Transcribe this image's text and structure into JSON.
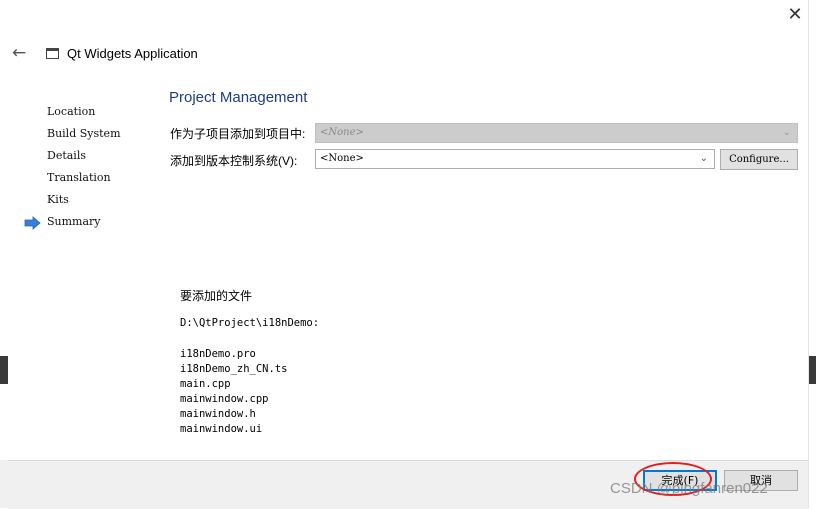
{
  "window": {
    "close_glyph": "✕",
    "back_glyph": "←",
    "title": "Qt Widgets Application"
  },
  "steps": [
    {
      "label": "Location"
    },
    {
      "label": "Build System"
    },
    {
      "label": "Details"
    },
    {
      "label": "Translation"
    },
    {
      "label": "Kits"
    },
    {
      "label": "Summary",
      "current": true
    }
  ],
  "page": {
    "title": "Project Management",
    "subproject_label": "作为子项目添加到项目中:",
    "subproject_value": "<None>",
    "vcs_label": "添加到版本控制系统(V):",
    "vcs_value": "<None>",
    "configure_label": "Configure..."
  },
  "summary": {
    "title": "要添加的文件",
    "path": "D:\\QtProject\\i18nDemo:",
    "files": [
      "i18nDemo.pro",
      "i18nDemo_zh_CN.ts",
      "main.cpp",
      "mainwindow.cpp",
      "mainwindow.h",
      "mainwindow.ui"
    ]
  },
  "footer": {
    "finish_label": "完成(F)",
    "cancel_label": "取消"
  },
  "watermark": "CSDN @pingfanren022",
  "colors": {
    "accent": "#1f3c88",
    "arrow": "#3b7fd4",
    "highlight": "#e02020"
  }
}
